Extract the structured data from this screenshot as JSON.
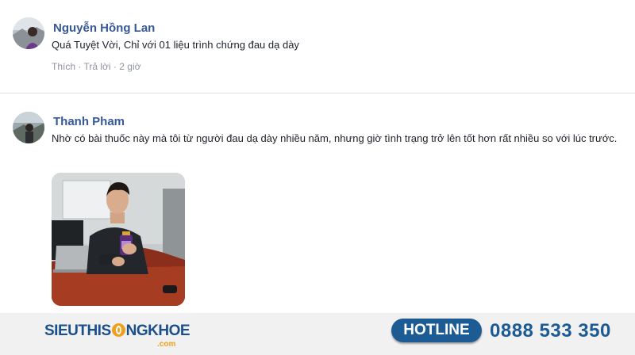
{
  "comments": [
    {
      "author": "Nguyễn Hồng Lan",
      "text": "Quá Tuyệt Vời, Chỉ với 01 liệu trình chứng đau dạ dày",
      "actions": {
        "like": "Thích",
        "reply": "Trả lời",
        "time": "2 giờ"
      }
    },
    {
      "author": "Thanh Pham",
      "text": "Nhờ có bài thuốc này mà tôi từ người đau dạ dày nhiều năm, nhưng giờ tình trạng trở lên tốt hơn rất nhiều so với lúc trước."
    }
  ],
  "footer": {
    "logo_prefix": "SIEUTHIS",
    "logo_suffix": "NGKHOE",
    "logo_domain": ".com",
    "hotline_label": "HOTLINE",
    "hotline_number": "0888 533 350"
  },
  "colors": {
    "author": "#365899",
    "brand": "#1c5b94",
    "accent": "#f0a020"
  }
}
